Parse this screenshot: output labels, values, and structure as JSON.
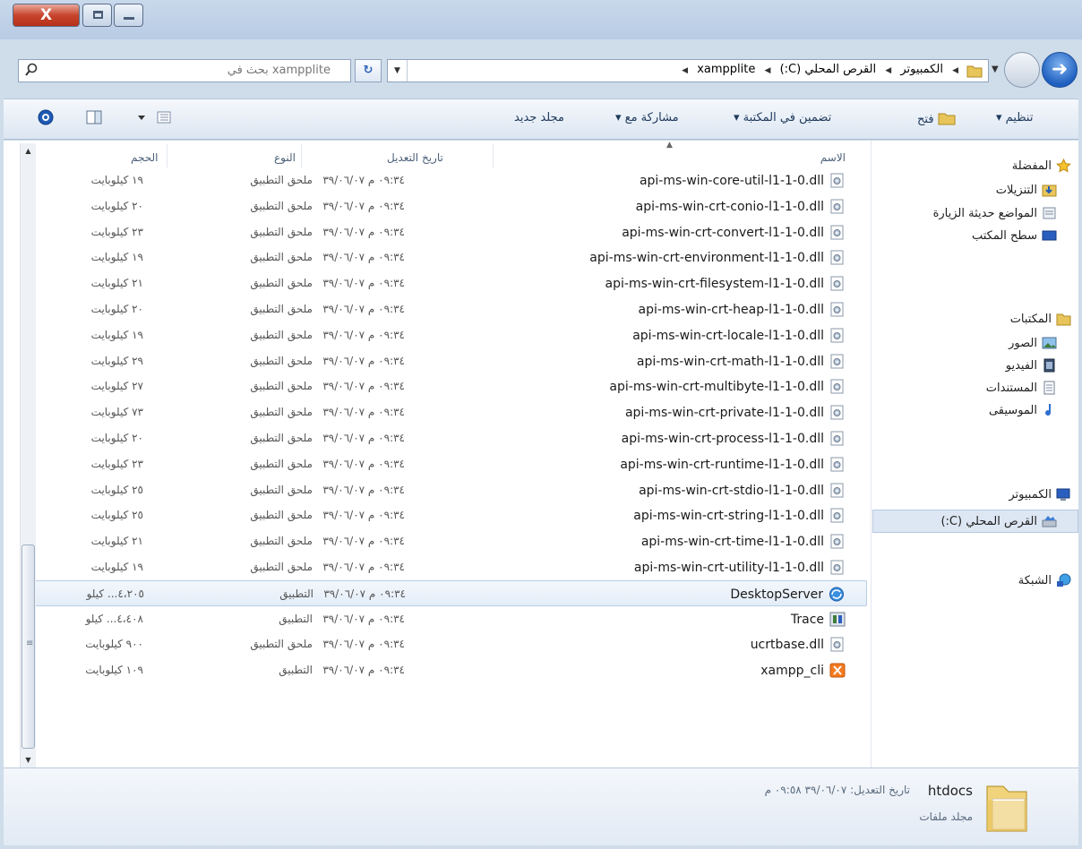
{
  "window": {
    "close_label": "X"
  },
  "address": {
    "search_placeholder": "بحث في xampplite",
    "crumbs": [
      "الكمبيوتر",
      "القرص المحلي (C:)",
      "xampplite"
    ]
  },
  "toolbar": {
    "organize": "تنظيم ▾",
    "open": "فتح",
    "include_library": "تضمين في المكتبة ▾",
    "share_with": "مشاركة مع ▾",
    "new_folder": "مجلد جديد"
  },
  "columns": {
    "name": "الاسم",
    "date": "تاريخ التعديل",
    "type": "النوع",
    "size": "الحجم"
  },
  "files": [
    {
      "name": "api-ms-win-core-util-l1-1-0.dll",
      "date": "٠٩:٣٤ م ٣٩/٠٦/٠٧",
      "type": "ملحق التطبيق",
      "size": "١٩ كيلوبايت",
      "icon": "dll-icon"
    },
    {
      "name": "api-ms-win-crt-conio-l1-1-0.dll",
      "date": "٠٩:٣٤ م ٣٩/٠٦/٠٧",
      "type": "ملحق التطبيق",
      "size": "٢٠ كيلوبايت",
      "icon": "dll-icon"
    },
    {
      "name": "api-ms-win-crt-convert-l1-1-0.dll",
      "date": "٠٩:٣٤ م ٣٩/٠٦/٠٧",
      "type": "ملحق التطبيق",
      "size": "٢٣ كيلوبايت",
      "icon": "dll-icon"
    },
    {
      "name": "api-ms-win-crt-environment-l1-1-0.dll",
      "date": "٠٩:٣٤ م ٣٩/٠٦/٠٧",
      "type": "ملحق التطبيق",
      "size": "١٩ كيلوبايت",
      "icon": "dll-icon"
    },
    {
      "name": "api-ms-win-crt-filesystem-l1-1-0.dll",
      "date": "٠٩:٣٤ م ٣٩/٠٦/٠٧",
      "type": "ملحق التطبيق",
      "size": "٢١ كيلوبايت",
      "icon": "dll-icon"
    },
    {
      "name": "api-ms-win-crt-heap-l1-1-0.dll",
      "date": "٠٩:٣٤ م ٣٩/٠٦/٠٧",
      "type": "ملحق التطبيق",
      "size": "٢٠ كيلوبايت",
      "icon": "dll-icon"
    },
    {
      "name": "api-ms-win-crt-locale-l1-1-0.dll",
      "date": "٠٩:٣٤ م ٣٩/٠٦/٠٧",
      "type": "ملحق التطبيق",
      "size": "١٩ كيلوبايت",
      "icon": "dll-icon"
    },
    {
      "name": "api-ms-win-crt-math-l1-1-0.dll",
      "date": "٠٩:٣٤ م ٣٩/٠٦/٠٧",
      "type": "ملحق التطبيق",
      "size": "٢٩ كيلوبايت",
      "icon": "dll-icon"
    },
    {
      "name": "api-ms-win-crt-multibyte-l1-1-0.dll",
      "date": "٠٩:٣٤ م ٣٩/٠٦/٠٧",
      "type": "ملحق التطبيق",
      "size": "٢٧ كيلوبايت",
      "icon": "dll-icon"
    },
    {
      "name": "api-ms-win-crt-private-l1-1-0.dll",
      "date": "٠٩:٣٤ م ٣٩/٠٦/٠٧",
      "type": "ملحق التطبيق",
      "size": "٧٣ كيلوبايت",
      "icon": "dll-icon"
    },
    {
      "name": "api-ms-win-crt-process-l1-1-0.dll",
      "date": "٠٩:٣٤ م ٣٩/٠٦/٠٧",
      "type": "ملحق التطبيق",
      "size": "٢٠ كيلوبايت",
      "icon": "dll-icon"
    },
    {
      "name": "api-ms-win-crt-runtime-l1-1-0.dll",
      "date": "٠٩:٣٤ م ٣٩/٠٦/٠٧",
      "type": "ملحق التطبيق",
      "size": "٢٣ كيلوبايت",
      "icon": "dll-icon"
    },
    {
      "name": "api-ms-win-crt-stdio-l1-1-0.dll",
      "date": "٠٩:٣٤ م ٣٩/٠٦/٠٧",
      "type": "ملحق التطبيق",
      "size": "٢٥ كيلوبايت",
      "icon": "dll-icon"
    },
    {
      "name": "api-ms-win-crt-string-l1-1-0.dll",
      "date": "٠٩:٣٤ م ٣٩/٠٦/٠٧",
      "type": "ملحق التطبيق",
      "size": "٢٥ كيلوبايت",
      "icon": "dll-icon"
    },
    {
      "name": "api-ms-win-crt-time-l1-1-0.dll",
      "date": "٠٩:٣٤ م ٣٩/٠٦/٠٧",
      "type": "ملحق التطبيق",
      "size": "٢١ كيلوبايت",
      "icon": "dll-icon"
    },
    {
      "name": "api-ms-win-crt-utility-l1-1-0.dll",
      "date": "٠٩:٣٤ م ٣٩/٠٦/٠٧",
      "type": "ملحق التطبيق",
      "size": "١٩ كيلوبايت",
      "icon": "dll-icon"
    },
    {
      "name": "DesktopServer",
      "date": "٠٩:٣٤ م ٣٩/٠٦/٠٧",
      "type": "التطبيق",
      "size": "٤،٢٠٥... كيلو",
      "icon": "desktopserver-icon"
    },
    {
      "name": "Trace",
      "date": "٠٩:٣٤ م ٣٩/٠٦/٠٧",
      "type": "التطبيق",
      "size": "٤،٤٠٨... كيلو",
      "icon": "trace-icon"
    },
    {
      "name": "ucrtbase.dll",
      "date": "٠٩:٣٤ م ٣٩/٠٦/٠٧",
      "type": "ملحق التطبيق",
      "size": "٩٠٠ كيلوبايت",
      "icon": "dll-icon"
    },
    {
      "name": "xampp_cli",
      "date": "٠٩:٣٤ م ٣٩/٠٦/٠٧",
      "type": "التطبيق",
      "size": "١٠٩ كيلوبايت",
      "icon": "xampp-icon"
    }
  ],
  "nav": {
    "favorites": "المفضلة",
    "downloads": "التنزيلات",
    "recent": "المواضع حديثة الزيارة",
    "desktop": "سطح المكتب",
    "libraries": "المكتبات",
    "pictures": "الصور",
    "videos": "الفيديو",
    "documents": "المستندات",
    "music": "الموسيقى",
    "computer": "الكمبيوتر",
    "local_disk": "القرص المحلي (C:)",
    "network": "الشبكة"
  },
  "details": {
    "name": "htdocs",
    "modified": "تاريخ التعديل: ٣٩/٠٦/٠٧ ٠٩:٥٨ م",
    "type": "مجلد ملفات"
  },
  "colors": {
    "selected_row": "#e4edf8",
    "accent": "#1e5fbf"
  }
}
